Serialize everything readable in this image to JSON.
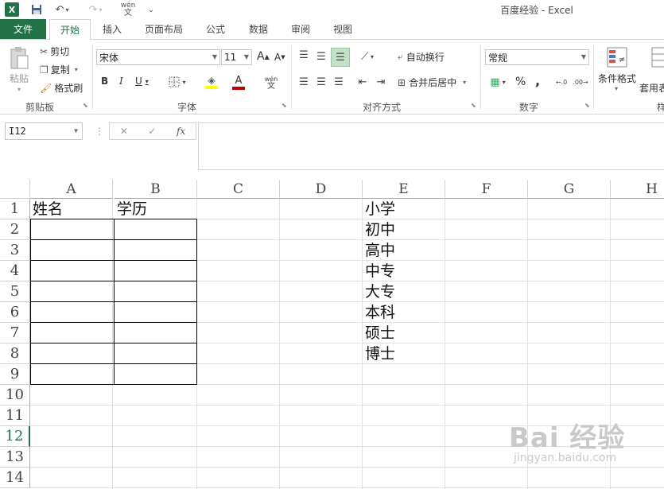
{
  "window": {
    "title": "百度经验 - Excel"
  },
  "quick_access": {
    "undo": "↶",
    "redo": "↷",
    "phonetic": "wén",
    "customize": "⌄"
  },
  "tabs": [
    {
      "label": "文件",
      "name": "tab-file"
    },
    {
      "label": "开始",
      "name": "tab-home",
      "active": true
    },
    {
      "label": "插入",
      "name": "tab-insert"
    },
    {
      "label": "页面布局",
      "name": "tab-page-layout"
    },
    {
      "label": "公式",
      "name": "tab-formulas"
    },
    {
      "label": "数据",
      "name": "tab-data"
    },
    {
      "label": "审阅",
      "name": "tab-review"
    },
    {
      "label": "视图",
      "name": "tab-view"
    }
  ],
  "ribbon": {
    "clipboard": {
      "label": "剪贴板",
      "paste": "粘贴",
      "cut": "剪切",
      "copy": "复制",
      "format_painter": "格式刷"
    },
    "font": {
      "label": "字体",
      "font_name": "宋体",
      "font_size": "11",
      "bold": "B",
      "italic": "I",
      "underline": "U",
      "grow": "A",
      "shrink": "A",
      "phonetic": "wén"
    },
    "alignment": {
      "label": "对齐方式",
      "wrap_text": "自动换行",
      "merge_center": "合并后居中"
    },
    "number": {
      "label": "数字",
      "format": "常规",
      "percent": "%",
      "comma": ","
    },
    "styles": {
      "conditional": "条件格式",
      "table_format": "套用表格格式",
      "truncated": "样"
    }
  },
  "formula_bar": {
    "name_box": "I12",
    "cancel": "✕",
    "enter": "✓",
    "fx": "fx",
    "formula": ""
  },
  "sheet": {
    "columns": [
      "A",
      "B",
      "C",
      "D",
      "E",
      "F",
      "G",
      "H"
    ],
    "rows": [
      "1",
      "2",
      "3",
      "4",
      "5",
      "6",
      "7",
      "8",
      "9",
      "10",
      "11",
      "12",
      "13",
      "14"
    ],
    "active_row": "12",
    "cells": {
      "A1": "姓名",
      "B1": "学历",
      "E1": "小学",
      "E2": "初中",
      "E3": "高中",
      "E4": "中专",
      "E5": "大专",
      "E6": "本科",
      "E7": "硕士",
      "E8": "博士"
    }
  },
  "watermark": {
    "logo": "Bai 经验",
    "url": "jingyan.baidu.com"
  }
}
